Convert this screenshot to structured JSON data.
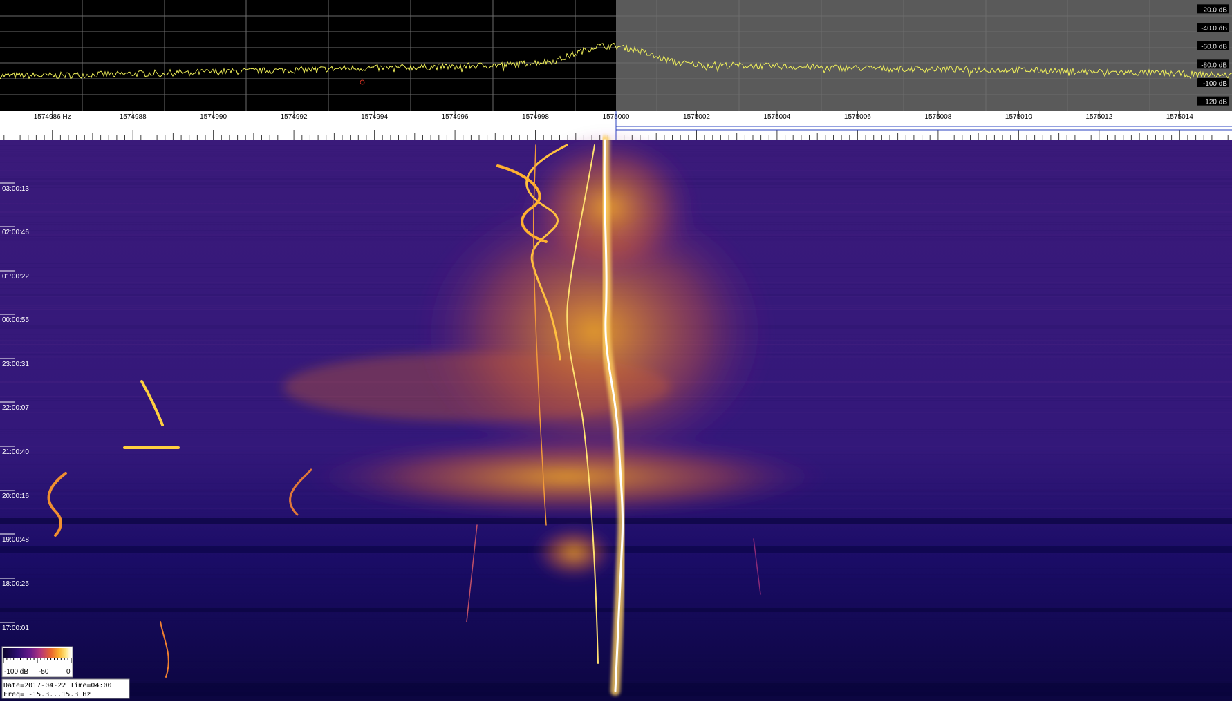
{
  "chart_data": {
    "type": "heatmap",
    "title": "",
    "spectrum": {
      "y_unit": "dB",
      "y_range": [
        -130,
        -10
      ],
      "y_tick_labels": [
        "-20.0 dB",
        "-40.0 dB",
        "-60.0 dB",
        "-80.0 dB",
        "-100 dB",
        "-120 dB"
      ],
      "y_tick_values": [
        -20,
        -40,
        -60,
        -80,
        -100,
        -120
      ],
      "highlighted_span_hz": [
        1575000,
        1575015.3
      ],
      "series": [
        {
          "x_hz": [
            1574984.7,
            1574986,
            1574988,
            1574990,
            1574992,
            1574993.5,
            1574994,
            1574996,
            1574997.5,
            1574998.5,
            1574999,
            1574999.5,
            1575000,
            1575000.5,
            1575001,
            1575001.5,
            1575002,
            1575004,
            1575006,
            1575008,
            1575010,
            1575012,
            1575014,
            1575015.3
          ],
          "y_db": [
            -92,
            -92,
            -90,
            -88,
            -86,
            -84,
            -84,
            -82,
            -80,
            -76,
            -68,
            -60,
            -60,
            -64,
            -72,
            -78,
            -80,
            -82,
            -84,
            -85,
            -86,
            -88,
            -90,
            -92
          ]
        }
      ]
    },
    "waterfall": {
      "x_unit": "Hz",
      "x_range": [
        1574984.7,
        1575015.3
      ],
      "x_tick_labels": [
        "1574986 Hz",
        "1574988",
        "1574990",
        "1574992",
        "1574994",
        "1574996",
        "1574998",
        "1575000",
        "1575002",
        "1575004",
        "1575006",
        "1575008",
        "1575010",
        "1575012",
        "1575014"
      ],
      "x_tick_values": [
        1574986,
        1574988,
        1574990,
        1574992,
        1574994,
        1574996,
        1574998,
        1575000,
        1575002,
        1575004,
        1575006,
        1575008,
        1575010,
        1575012,
        1575014
      ],
      "time_labels": [
        "03:00:13",
        "02:00:46",
        "01:00:22",
        "00:00:55",
        "23:00:31",
        "22:00:07",
        "21:00:40",
        "20:00:16",
        "19:00:48",
        "18:00:25",
        "17:00:01"
      ],
      "colorscale_range_db": [
        -100,
        0
      ],
      "colors": [
        "#0d0530",
        "#2b0e6e",
        "#6a1b8a",
        "#b5367a",
        "#e8642e",
        "#fbb02c",
        "#ffe680",
        "#ffffff"
      ]
    },
    "legend": {
      "scale_labels": [
        "-100 dB",
        "-50",
        "0"
      ]
    },
    "info": {
      "line1": "Date=2017-04-22 Time=04:00",
      "line2": "Freq= -15.3...15.3 Hz"
    }
  }
}
